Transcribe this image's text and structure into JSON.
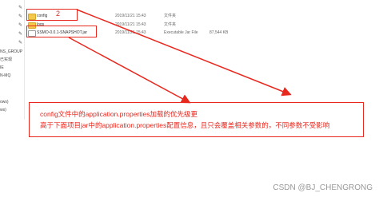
{
  "sidebar": {
    "items": [
      {
        "label": "",
        "pinned": true
      },
      {
        "label": "",
        "pinned": true
      },
      {
        "label": "",
        "pinned": true
      },
      {
        "label": "",
        "pinned": true
      },
      {
        "label": "",
        "pinned": true
      },
      {
        "label": "NS_GROUP",
        "pinned": false
      },
      {
        "label": "已实现",
        "pinned": false
      },
      {
        "label": "IE",
        "pinned": false
      },
      {
        "label": "N-MQ",
        "pinned": false
      },
      {
        "label": "",
        "pinned": false
      },
      {
        "label": "ows)",
        "pinned": false
      },
      {
        "label": "ws)",
        "pinned": false
      }
    ]
  },
  "files": [
    {
      "name": "config",
      "date": "2019/11/21 15:43",
      "type": "文件夹",
      "size": "",
      "icon": "folder-icon"
    },
    {
      "name": "logs",
      "date": "2019/11/21 15:43",
      "type": "文件夹",
      "size": "",
      "icon": "folder-icon"
    },
    {
      "name": "SSMO-0.0.1-SNAPSHOT.jar",
      "date": "2019/11/21 15:43",
      "type": "Executable Jar File",
      "size": "87,544 KB",
      "icon": "jar-file-icon"
    }
  ],
  "annotation": {
    "number": "2",
    "line1": "config文件中的application.properties加载的优先级更",
    "line2": "高于下面项目jar中的application.properties配置信息，且只会覆盖相关参数的，不同参数不受影响"
  },
  "colors": {
    "annotation": "#e8271d"
  },
  "watermark": "CSDN @BJ_CHENGRONG"
}
